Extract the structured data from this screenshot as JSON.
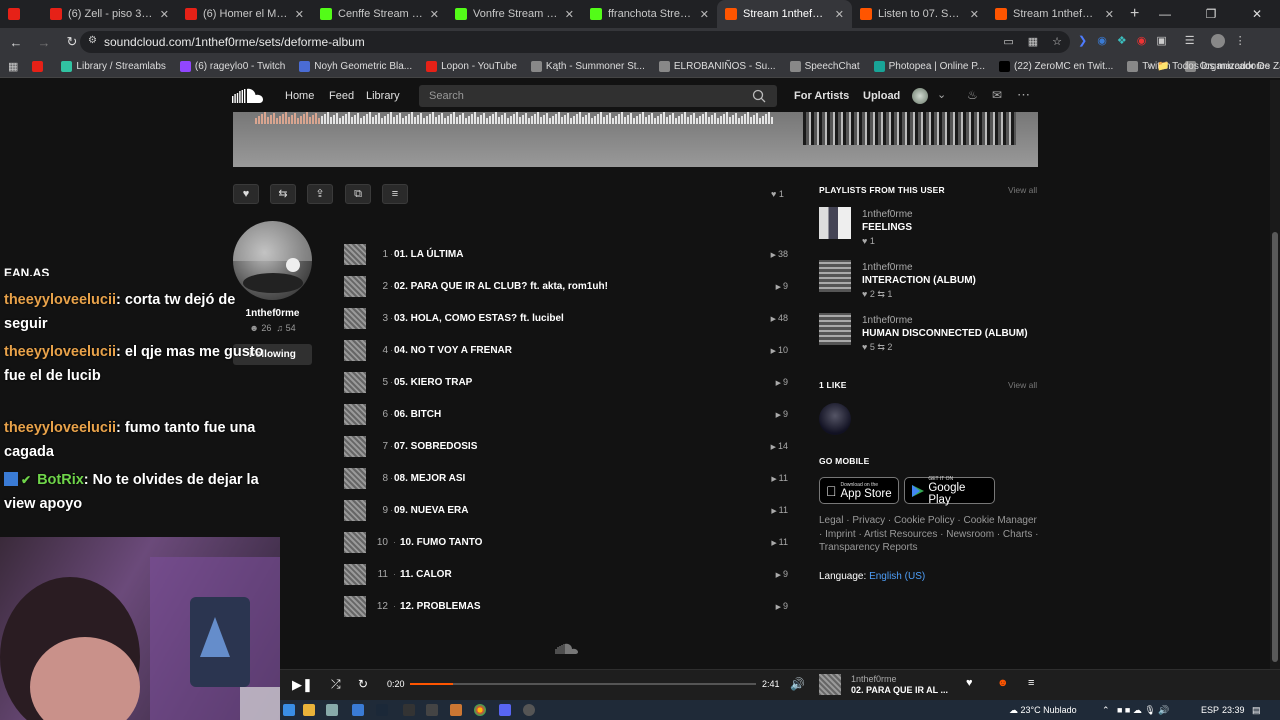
{
  "browser": {
    "tabs": [
      {
        "title": "",
        "color": "#e62117"
      },
      {
        "title": "(6) Zell - piso 3 (Audio O",
        "color": "#e62117"
      },
      {
        "title": "(6) Homer el Mero Merc",
        "color": "#e62117"
      },
      {
        "title": "Cenffe Stream - Watch L",
        "color": "#53fc18"
      },
      {
        "title": "Vonfre Stream - Wat",
        "color": "#53fc18"
      },
      {
        "title": "ffranchota Stream - ",
        "color": "#53fc18"
      },
      {
        "title": "Stream 1nthef0rme | List",
        "color": "#ff5500",
        "active": true
      },
      {
        "title": "Listen to 07. SOBREDOS",
        "color": "#ff5500"
      },
      {
        "title": "Stream 1nthef0rme mus",
        "color": "#ff5500"
      }
    ],
    "url": "soundcloud.com/1nthef0rme/sets/deforme-album",
    "bookmarks": [
      {
        "label": "",
        "color": "#e62117"
      },
      {
        "label": "Library / Streamlabs",
        "color": "#31c3a2"
      },
      {
        "label": "(6) rageylo0 - Twitch",
        "color": "#9146ff"
      },
      {
        "label": "Noyh Geometric Bla...",
        "color": "#4a6cd4"
      },
      {
        "label": "Lopon - YouTube",
        "color": "#e62117"
      },
      {
        "label": "Kąth - Summoner St...",
        "color": "#888888"
      },
      {
        "label": "ELROBANIÑOS - Su...",
        "color": "#888888"
      },
      {
        "label": "SpeechChat",
        "color": "#888888"
      },
      {
        "label": "Photopea | Online P...",
        "color": "#18a497"
      },
      {
        "label": "(22) ZeroMC en Twit...",
        "color": "#000000"
      },
      {
        "label": "Twitch",
        "color": "#888888"
      },
      {
        "label": "Organizador De Zap...",
        "color": "#888888"
      }
    ],
    "all_bookmarks": "Todos los marcadores"
  },
  "header": {
    "home": "Home",
    "feed": "Feed",
    "library": "Library",
    "search_placeholder": "Search",
    "for_artists": "For Artists",
    "upload": "Upload"
  },
  "playlist": {
    "like_count": "1",
    "artist": "1nthef0rme",
    "followers": "26",
    "tracks_count": "54",
    "following_label": "Following",
    "tracks": [
      {
        "n": "1",
        "title": "01. LA ÚLTIMA",
        "plays": "38"
      },
      {
        "n": "2",
        "title": "02. PARA QUE IR AL CLUB? ft. akta, rom1uh!",
        "plays": "9"
      },
      {
        "n": "3",
        "title": "03. HOLA, COMO ESTAS? ft. lucibel",
        "plays": "48"
      },
      {
        "n": "4",
        "title": "04. NO T VOY A FRENAR",
        "plays": "10"
      },
      {
        "n": "5",
        "title": "05. KIERO TRAP",
        "plays": "9"
      },
      {
        "n": "6",
        "title": "06. BITCH",
        "plays": "9"
      },
      {
        "n": "7",
        "title": "07. SOBREDOSIS",
        "plays": "14"
      },
      {
        "n": "8",
        "title": "08. MEJOR ASI",
        "plays": "11"
      },
      {
        "n": "9",
        "title": "09. NUEVA ERA",
        "plays": "11"
      },
      {
        "n": "10",
        "title": "10. FUMO TANTO",
        "plays": "11"
      },
      {
        "n": "11",
        "title": "11. CALOR",
        "plays": "9"
      },
      {
        "n": "12",
        "title": "12. PROBLEMAS",
        "plays": "9"
      }
    ]
  },
  "sidebar": {
    "playlists_heading": "PLAYLISTS FROM THIS USER",
    "view_all": "View all",
    "playlists": [
      {
        "user": "1nthef0rme",
        "title": "FEELINGS",
        "likes": "1",
        "reposts": ""
      },
      {
        "user": "1nthef0rme",
        "title": "INTERACTION (ALBUM)",
        "likes": "2",
        "reposts": "1"
      },
      {
        "user": "1nthef0rme",
        "title": "HUMAN DISCONNECTED (ALBUM)",
        "likes": "5",
        "reposts": "2"
      }
    ],
    "likes_heading": "1 LIKE",
    "go_mobile": "GO MOBILE",
    "app_store_small": "Download on the",
    "app_store_big": "App Store",
    "google_small": "GET IT ON",
    "google_big": "Google Play",
    "footer_links": "Legal · Privacy · Cookie Policy · Cookie Manager · Imprint · Artist Resources · Newsroom · Charts · Transparency Reports",
    "language_label": "Language:",
    "language_value": "English (US)"
  },
  "chat": {
    "cut_line": "EAN.AS",
    "messages": [
      {
        "user": "theeyyloveelucii",
        "text": ": corta tw dejó de seguir"
      },
      {
        "user": "theeyyloveelucii",
        "text": ": el qje mas me gusto fue el de lucib"
      },
      {
        "user": "theeyyloveelucii",
        "text": ": fumo tanto fue una cagada"
      },
      {
        "user": "BotRix",
        "text": ": No te olvides de dejar la view apoyo"
      }
    ]
  },
  "player": {
    "elapsed": "0:20",
    "duration": "2:41",
    "progress": 0.124,
    "artist": "1nthef0rme",
    "title": "02. PARA QUE IR AL ..."
  },
  "taskbar": {
    "weather": "23°C  Nublado",
    "lang": "ESP",
    "time": "23:39"
  },
  "colors": {
    "accent": "#ff5500",
    "link": "#4e9ef7"
  }
}
